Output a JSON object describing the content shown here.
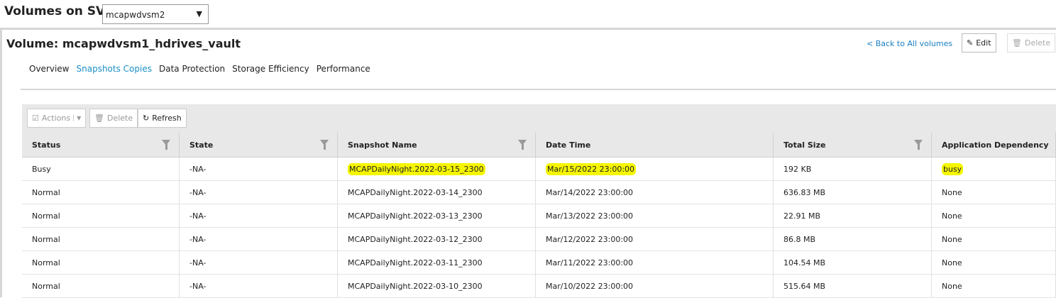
{
  "header": {
    "title": "Volumes on SVM",
    "svm_selected": "mcapwdvsm2"
  },
  "volume": {
    "title": "Volume: mcapwdvsm1_hdrives_vault",
    "back_link": "< Back to All volumes",
    "edit_label": "Edit",
    "delete_label": "Delete"
  },
  "tabs": [
    {
      "label": "Overview"
    },
    {
      "label": "Snapshots Copies"
    },
    {
      "label": "Data Protection"
    },
    {
      "label": "Storage Efficiency"
    },
    {
      "label": "Performance"
    }
  ],
  "toolbar": {
    "actions_label": "Actions",
    "delete_label": "Delete",
    "refresh_label": "Refresh"
  },
  "table": {
    "columns": [
      "Status",
      "State",
      "Snapshot Name",
      "Date Time",
      "Total Size",
      "Application Dependency"
    ],
    "rows": [
      [
        "Busy",
        "-NA-",
        "MCAPDailyNight.2022-03-15_2300",
        "Mar/15/2022 23:00:00",
        "192 KB",
        "busy"
      ],
      [
        "Normal",
        "-NA-",
        "MCAPDailyNight.2022-03-14_2300",
        "Mar/14/2022 23:00:00",
        "636.83 MB",
        "None"
      ],
      [
        "Normal",
        "-NA-",
        "MCAPDailyNight.2022-03-13_2300",
        "Mar/13/2022 23:00:00",
        "22.91 MB",
        "None"
      ],
      [
        "Normal",
        "-NA-",
        "MCAPDailyNight.2022-03-12_2300",
        "Mar/12/2022 23:00:00",
        "86.8 MB",
        "None"
      ],
      [
        "Normal",
        "-NA-",
        "MCAPDailyNight.2022-03-11_2300",
        "Mar/11/2022 23:00:00",
        "104.54 MB",
        "None"
      ],
      [
        "Normal",
        "-NA-",
        "MCAPDailyNight.2022-03-10_2300",
        "Mar/10/2022 23:00:00",
        "515.64 MB",
        "None"
      ]
    ]
  }
}
